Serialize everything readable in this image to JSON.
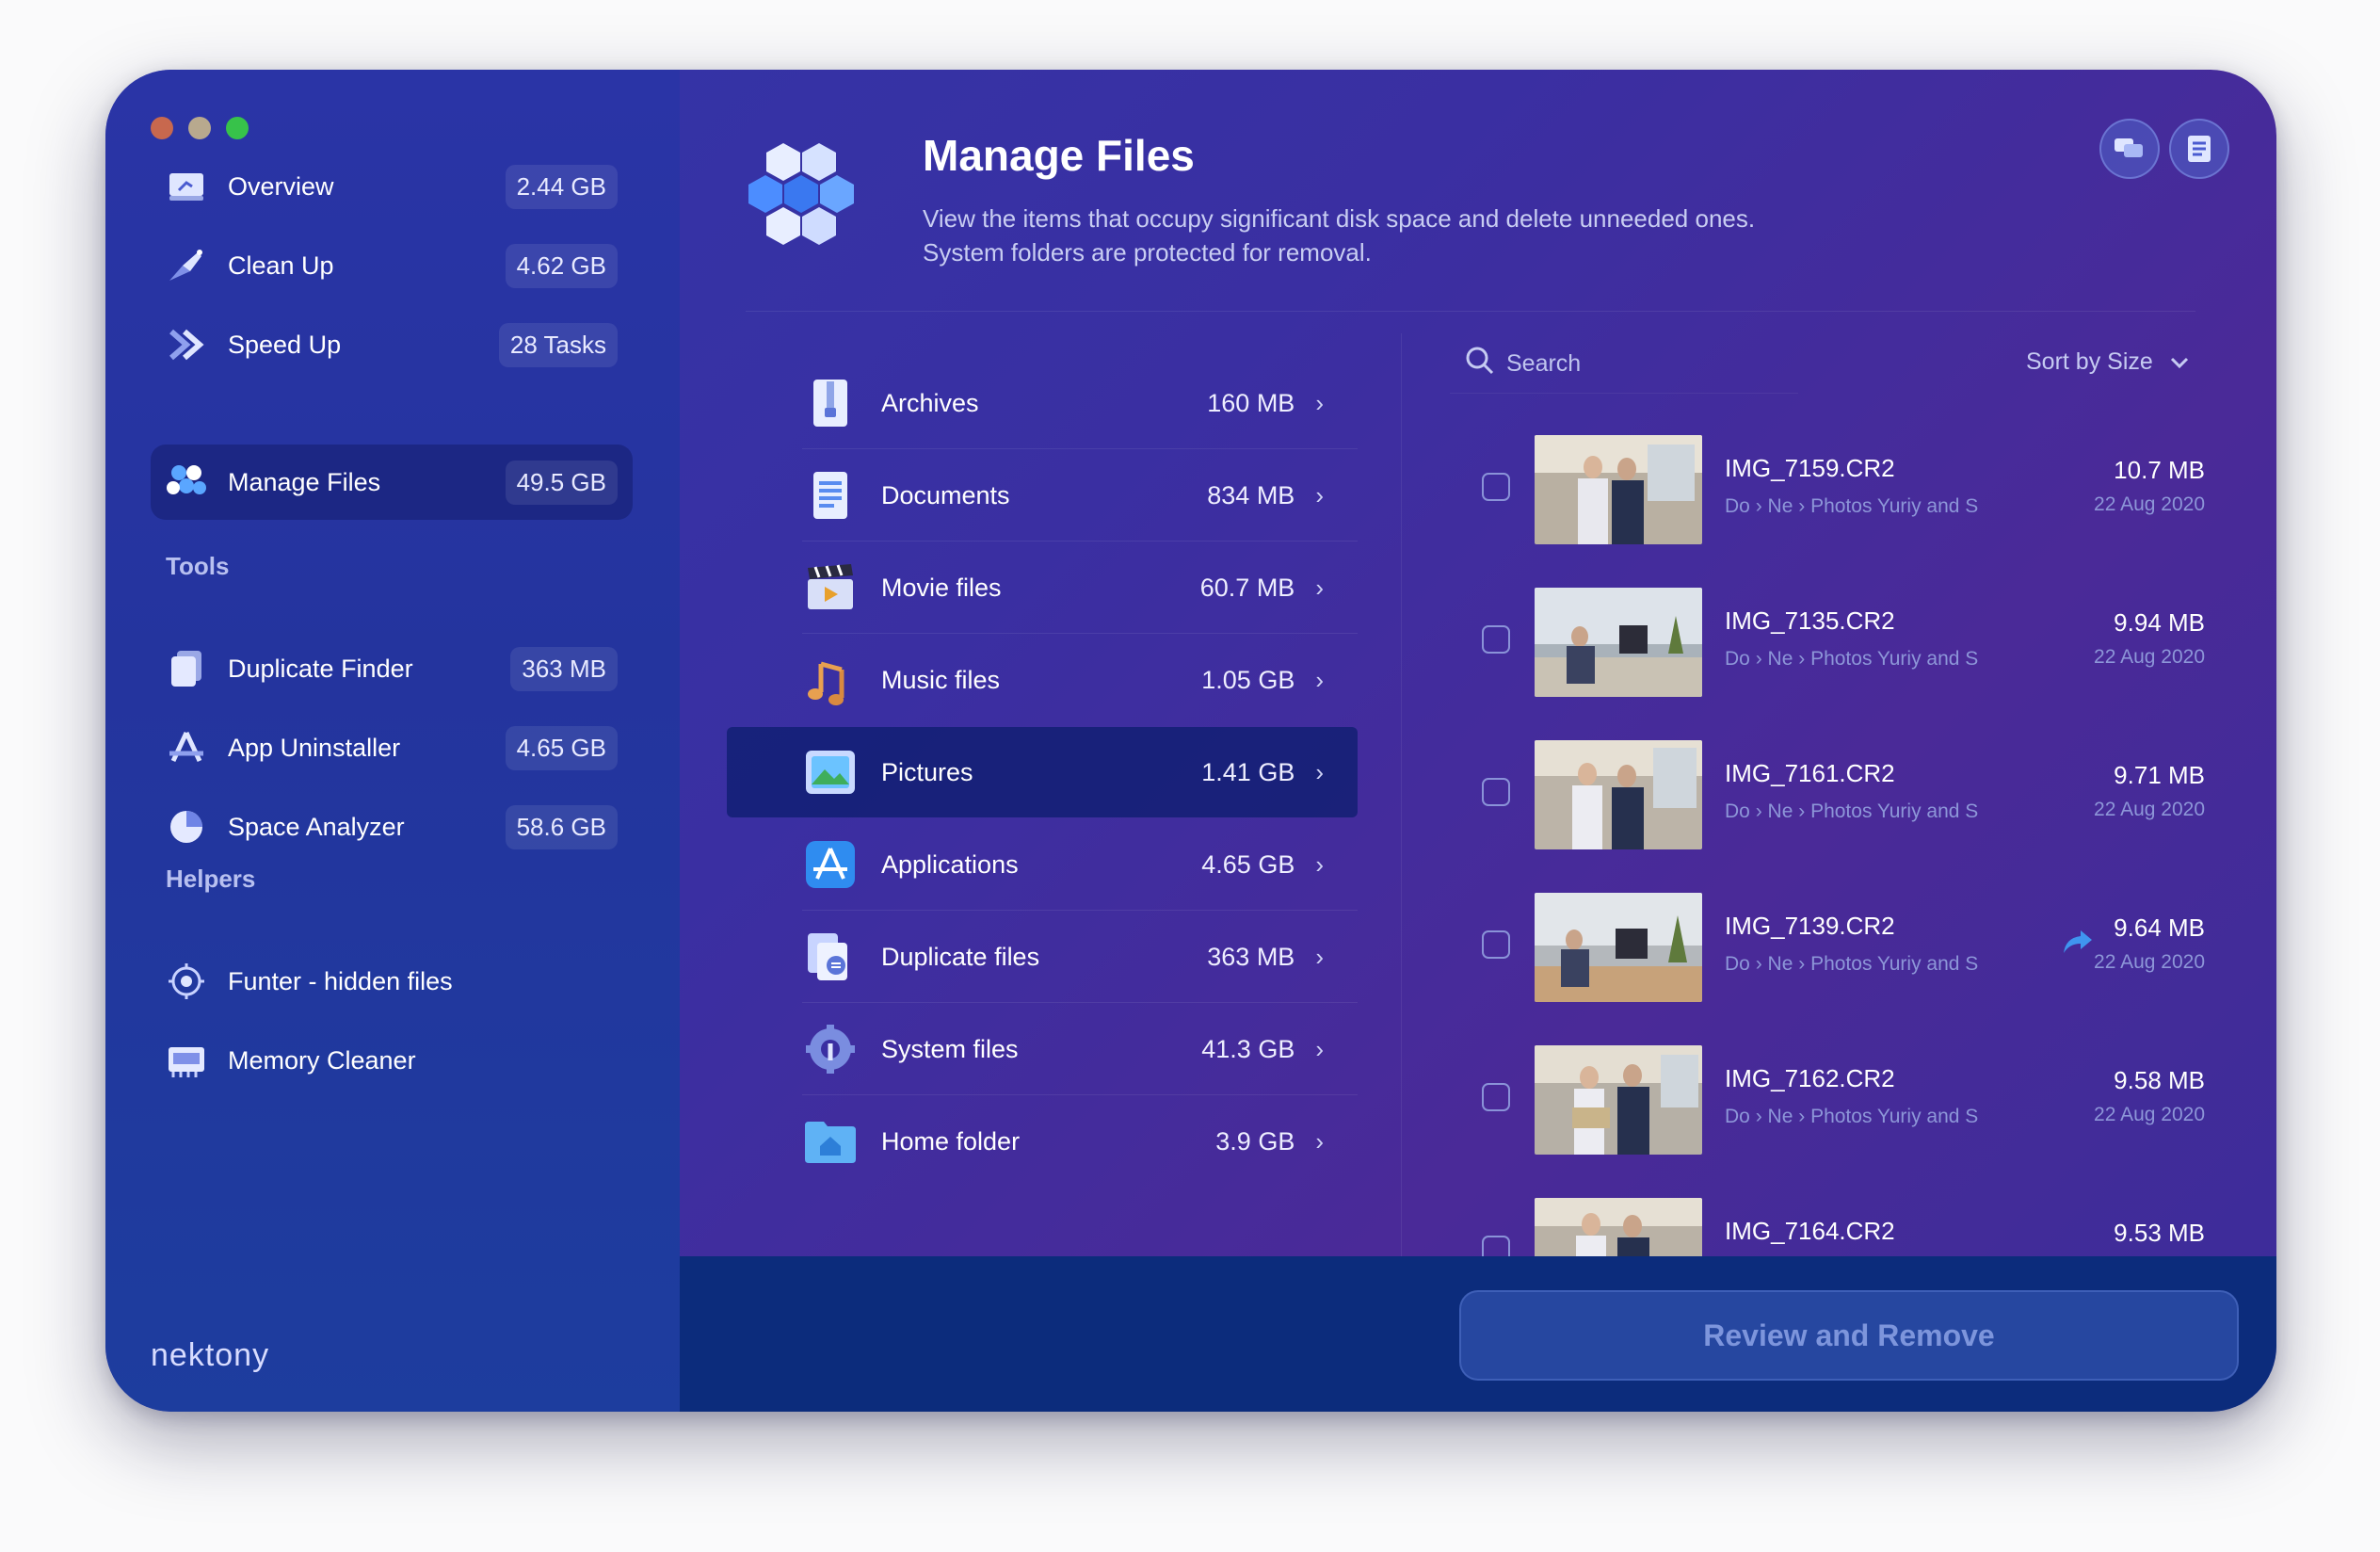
{
  "window": {
    "title": "Manage Files"
  },
  "sidebar": {
    "items": [
      {
        "label": "Overview",
        "value": "2.44 GB",
        "icon": "overview-icon"
      },
      {
        "label": "Clean Up",
        "value": "4.62 GB",
        "icon": "cleanup-icon"
      },
      {
        "label": "Speed Up",
        "value": "28 Tasks",
        "icon": "speedup-icon"
      },
      {
        "label": "Manage Files",
        "value": "49.5 GB",
        "icon": "manage-files-icon",
        "active": true
      }
    ],
    "tools_heading": "Tools",
    "tools": [
      {
        "label": "Duplicate Finder",
        "value": "363 MB",
        "icon": "duplicate-finder-icon"
      },
      {
        "label": "App Uninstaller",
        "value": "4.65 GB",
        "icon": "app-uninstaller-icon"
      },
      {
        "label": "Space Analyzer",
        "value": "58.6 GB",
        "icon": "space-analyzer-icon"
      }
    ],
    "helpers_heading": "Helpers",
    "helpers": [
      {
        "label": "Funter - hidden files",
        "icon": "funter-icon"
      },
      {
        "label": "Memory Cleaner",
        "icon": "memory-cleaner-icon"
      }
    ],
    "brand": "nektony"
  },
  "header": {
    "title": "Manage Files",
    "subtitle_line1": "View the items that occupy significant disk space and delete unneeded ones.",
    "subtitle_line2": "System folders are protected for removal."
  },
  "categories": [
    {
      "label": "Archives",
      "size": "160 MB",
      "icon": "archive-icon"
    },
    {
      "label": "Documents",
      "size": "834 MB",
      "icon": "documents-icon"
    },
    {
      "label": "Movie files",
      "size": "60.7 MB",
      "icon": "movie-icon"
    },
    {
      "label": "Music files",
      "size": "1.05 GB",
      "icon": "music-icon"
    },
    {
      "label": "Pictures",
      "size": "1.41 GB",
      "icon": "pictures-icon",
      "active": true
    },
    {
      "label": "Applications",
      "size": "4.65 GB",
      "icon": "applications-icon"
    },
    {
      "label": "Duplicate files",
      "size": "363 MB",
      "icon": "duplicate-files-icon"
    },
    {
      "label": "System files",
      "size": "41.3 GB",
      "icon": "system-files-icon"
    },
    {
      "label": "Home folder",
      "size": "3.9 GB",
      "icon": "home-folder-icon"
    }
  ],
  "search": {
    "placeholder": "Search"
  },
  "sort": {
    "label": "Sort by Size"
  },
  "path": {
    "seg1": "Do",
    "seg2": "Ne",
    "seg3": "Photos Yuriy and S"
  },
  "files": [
    {
      "name": "IMG_7159.CR2",
      "size": "10.7 MB",
      "date": "22 Aug 2020"
    },
    {
      "name": "IMG_7135.CR2",
      "size": "9.94 MB",
      "date": "22 Aug 2020"
    },
    {
      "name": "IMG_7161.CR2",
      "size": "9.71 MB",
      "date": "22 Aug 2020"
    },
    {
      "name": "IMG_7139.CR2",
      "size": "9.64 MB",
      "date": "22 Aug 2020"
    },
    {
      "name": "IMG_7162.CR2",
      "size": "9.58 MB",
      "date": "22 Aug 2020"
    },
    {
      "name": "IMG_7164.CR2",
      "size": "9.53 MB",
      "date": ""
    }
  ],
  "actions": {
    "review_remove": "Review and Remove"
  },
  "colors": {
    "accent": "#3a2fa2",
    "sidebar": "#24349e",
    "bottom_bar": "#0c2c7c"
  }
}
